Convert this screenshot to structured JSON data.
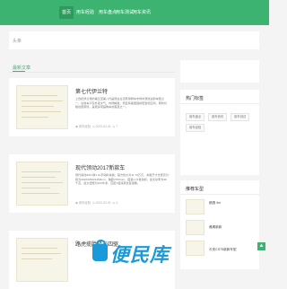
{
  "nav": {
    "items": [
      "首页",
      "用车经验",
      "用车盘点",
      "用车测试",
      "用车资讯"
    ],
    "active_index": 0
  },
  "search": {
    "placeholder": "头条",
    "value": "头条"
  },
  "section": {
    "title": "最新文章"
  },
  "articles": [
    {
      "title": "第七代伊兰特",
      "excerpt": "上世纪伊兰特的第五至第八代是现在主流家用轿车市场中受欢迎的车型之一，这款车不仅外观大气，内饰精致，而且有着很强的配置和空间，同时价格也很亲民，是很多家庭购车的首选之一。",
      "author": "用车经验",
      "date": "2023-02-24",
      "views": "7"
    },
    {
      "title": "现代领动2017新款车",
      "excerpt": "现代领动2017款1.4L手动时尚版，官方售价为11.79万元，车型尺寸长宽高分别为4610/1800/1450mm，轴距2700mm，搭载1.4T发动机，最大功率为96千瓦，最大扭矩为242牛米，匹配7速双离合变速箱。",
      "author": "用车经验",
      "date": "2023-02-24",
      "views": "4"
    },
    {
      "title": "路虎揽胜极光四驱",
      "excerpt": "",
      "author": "",
      "date": "",
      "views": ""
    }
  ],
  "sidebar": {
    "tags_heading": "热门标签",
    "tags": [
      "用车盘点",
      "用车资讯",
      "用车测试",
      "用车经验"
    ],
    "recommend_heading": "推荐车型",
    "recommend": [
      {
        "title": "朗逸 4m",
        "count": ""
      },
      {
        "title": "雅阁新款",
        "count": ""
      },
      {
        "title": "长安CS75新款车型",
        "count": ""
      }
    ]
  },
  "watermark": {
    "text": "便民库"
  },
  "colors": {
    "brand": "#3cb371",
    "watermark": "#1a9ad9"
  }
}
